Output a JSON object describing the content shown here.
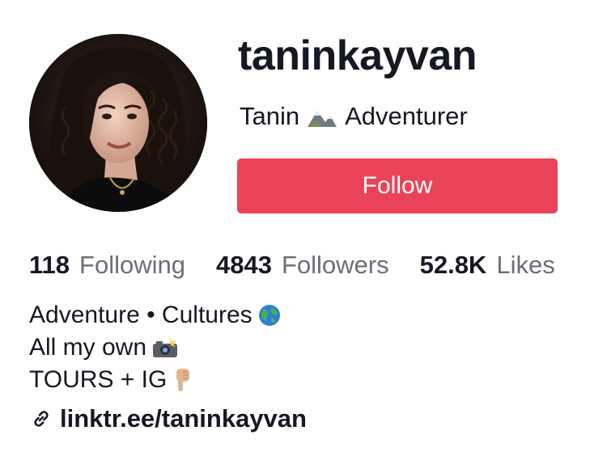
{
  "profile": {
    "username": "taninkayvan",
    "display_name_first": "Tanin",
    "display_name_icon": "mountain-icon",
    "display_name_rest": "Adventurer",
    "follow_label": "Follow",
    "follow_color": "#ea4359"
  },
  "stats": [
    {
      "value": "118",
      "label": "Following"
    },
    {
      "value": "4843",
      "label": "Followers"
    },
    {
      "value": "52.8K",
      "label": "Likes"
    }
  ],
  "bio": {
    "line1": "Adventure • Cultures",
    "line1_icon": "globe-icon",
    "line2": "All my own",
    "line2_icon": "camera-flash-icon",
    "line3": "TOURS + IG",
    "line3_icon": "pointing-down-icon"
  },
  "link": {
    "icon": "link-icon",
    "text": "linktr.ee/taninkayvan"
  }
}
